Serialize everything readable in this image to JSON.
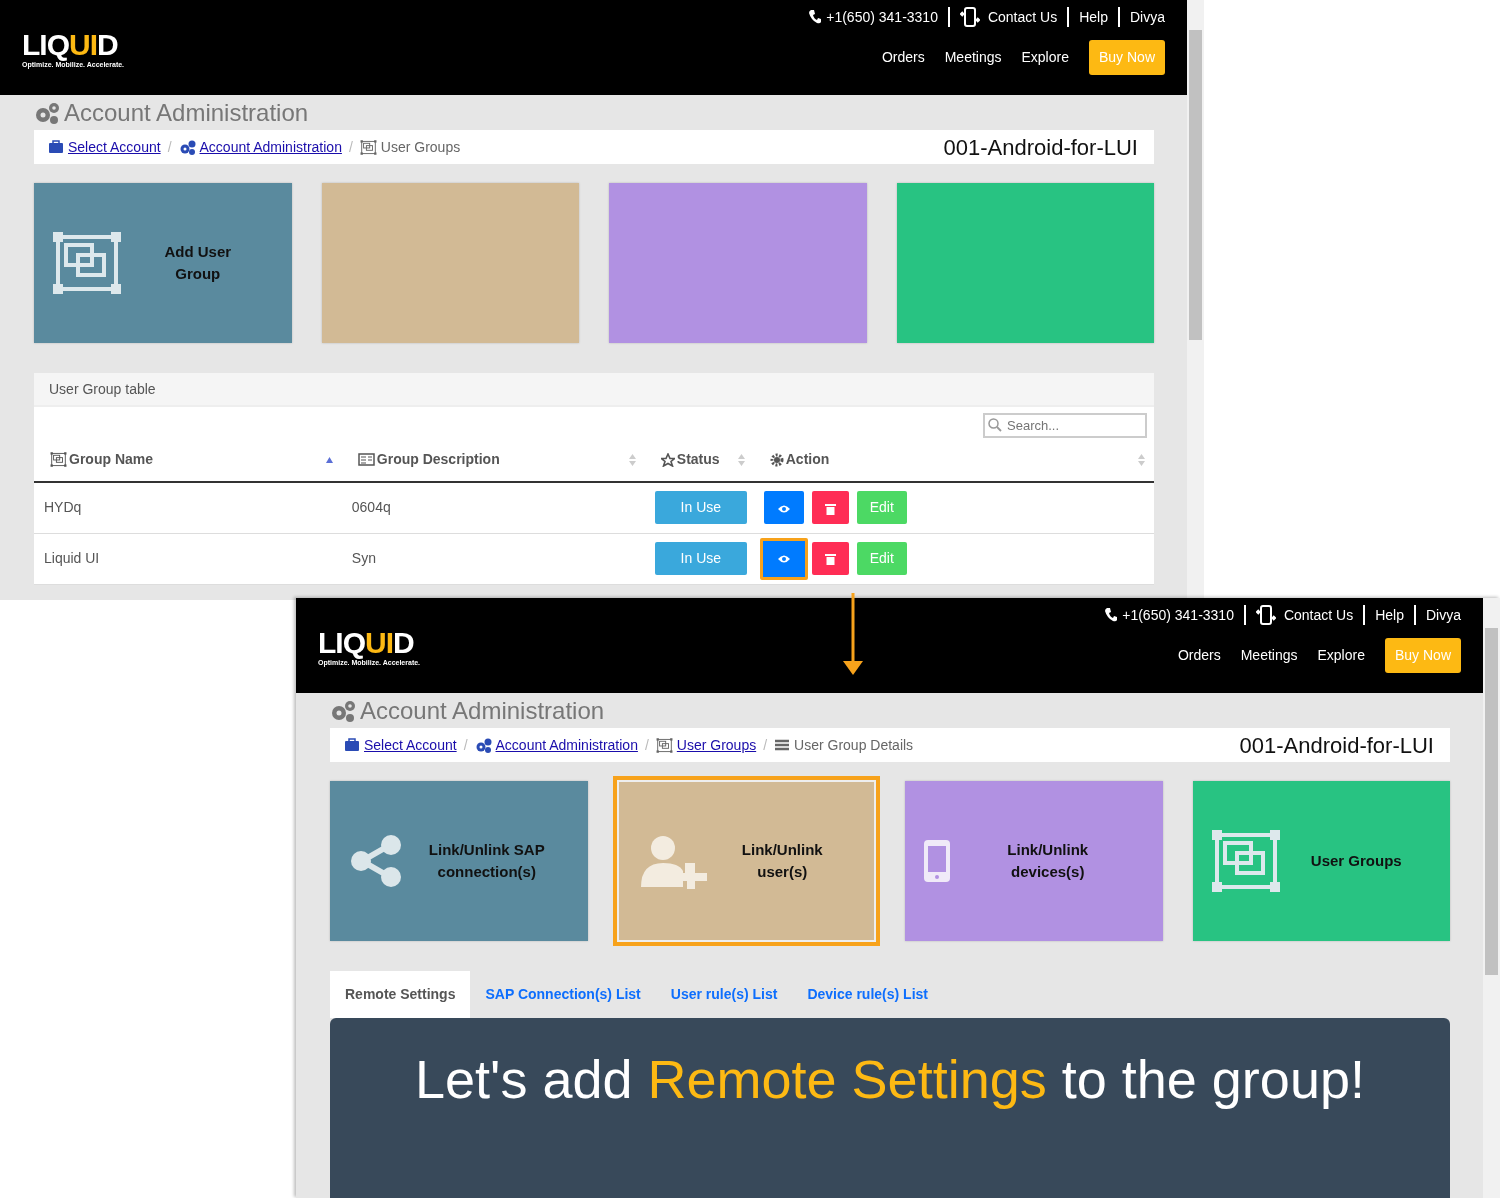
{
  "screens": [
    {
      "header": {
        "logo": {
          "prefix": "LIQ",
          "accent": "UI",
          "suffix": "D",
          "tagline": "Optimize. Mobilize. Accelerate."
        },
        "phone": "+1(650) 341-3310",
        "top_links": [
          "Contact Us",
          "Help",
          "Divya"
        ],
        "nav": [
          "Orders",
          "Meetings",
          "Explore"
        ],
        "buy": "Buy Now"
      },
      "page_title": "Account Administration",
      "breadcrumbs": [
        {
          "label": "Select Account",
          "link": true
        },
        {
          "separator": "/",
          "label": "Account Administration",
          "link": true
        },
        {
          "separator": "/",
          "label": "User Groups",
          "link": false
        }
      ],
      "account": "001-Android-for-LUI",
      "tiles": [
        {
          "label": "Add User Group",
          "color": "#5a8a9e",
          "highlighted": false
        },
        {
          "color": "#d2ba95",
          "highlighted": false
        },
        {
          "color": "#b191e2",
          "highlighted": false
        },
        {
          "color": "#28c382",
          "highlighted": false
        }
      ],
      "table": {
        "title": "User Group table",
        "search": {
          "placeholder": "Search..."
        },
        "columns": [
          {
            "label": "Group Name",
            "sorted": true
          },
          {
            "label": "Group Description",
            "sorted": false
          },
          {
            "label": "Status",
            "sorted": false
          },
          {
            "label": "Action",
            "sorted": false
          }
        ],
        "rows": [
          {
            "name": "HYDq",
            "description": "0604q",
            "status": "In Use",
            "edit": "Edit",
            "view_highlighted": false
          },
          {
            "name": "Liquid UI",
            "description": "Syn",
            "status": "In Use",
            "edit": "Edit",
            "view_highlighted": true
          }
        ]
      }
    },
    {
      "header": {
        "logo": {
          "prefix": "LIQ",
          "accent": "UI",
          "suffix": "D",
          "tagline": "Optimize. Mobilize. Accelerate."
        },
        "phone": "+1(650) 341-3310",
        "top_links": [
          "Contact Us",
          "Help",
          "Divya"
        ],
        "nav": [
          "Orders",
          "Meetings",
          "Explore"
        ],
        "buy": "Buy Now"
      },
      "page_title": "Account Administration",
      "breadcrumbs": [
        {
          "label": "Select Account",
          "link": true
        },
        {
          "separator": "/",
          "label": "Account Administration",
          "link": true
        },
        {
          "separator": "/",
          "label": "User Groups",
          "link": true
        },
        {
          "separator": "/",
          "label": "User Group Details",
          "link": false
        }
      ],
      "account": "001-Android-for-LUI",
      "tiles": [
        {
          "label": "Link/Unlink SAP connection(s)",
          "color": "#5a8a9e",
          "highlighted": false
        },
        {
          "label": "Link/Unlink user(s)",
          "color": "#d2ba95",
          "highlighted": true
        },
        {
          "label": "Link/Unlink devices(s)",
          "color": "#b191e2",
          "highlighted": false
        },
        {
          "label": "User Groups",
          "color": "#28c382",
          "highlighted": false
        }
      ],
      "tabs": [
        {
          "label": "Remote Settings",
          "selected": true
        },
        {
          "label": "SAP Connection(s) List",
          "selected": false
        },
        {
          "label": "User rule(s) List",
          "selected": false
        },
        {
          "label": "Device rule(s) List",
          "selected": false
        }
      ],
      "banner": {
        "before": "Let's add ",
        "highlight": "Remote Settings",
        "after": " to the group!"
      }
    }
  ]
}
